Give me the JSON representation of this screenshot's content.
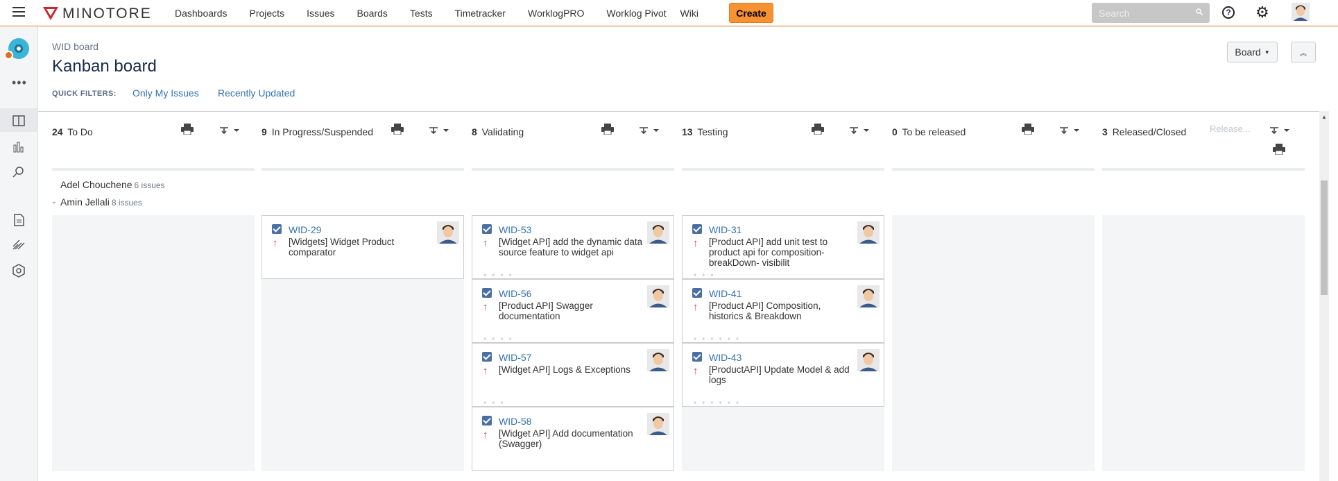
{
  "topbar": {
    "logo_text": "MINOTORE",
    "nav": [
      "Dashboards",
      "Projects",
      "Issues",
      "Boards",
      "Tests",
      "Timetracker",
      "WorklogPRO",
      "Worklog Pivot",
      "Wiki"
    ],
    "create_label": "Create",
    "search_placeholder": "Search",
    "help_glyph": "?",
    "accent": "#f79232"
  },
  "header": {
    "subtitle": "WID board",
    "title": "Kanban board",
    "board_button": "Board",
    "quick_filters_label": "QUICK FILTERS:",
    "quick_filters": [
      "Only My Issues",
      "Recently Updated"
    ]
  },
  "columns": [
    {
      "count": "24",
      "name": "To Do"
    },
    {
      "count": "9",
      "name": "In Progress/Suspended"
    },
    {
      "count": "8",
      "name": "Validating"
    },
    {
      "count": "13",
      "name": "Testing"
    },
    {
      "count": "0",
      "name": "To be released"
    },
    {
      "count": "3",
      "name": "Released/Closed",
      "release_text": "Release..."
    }
  ],
  "swimlanes": [
    {
      "name": "Adel Chouchene",
      "count": "6 issues"
    },
    {
      "name": "Amin Jellali",
      "count": "8 issues"
    }
  ],
  "cards": {
    "col1": [
      {
        "key": "WID-29",
        "summary": "[Widgets] Widget Product comparator"
      }
    ],
    "col2": [
      {
        "key": "WID-53",
        "summary": "[Widget API] add the dynamic data source feature to widget api"
      },
      {
        "key": "WID-56",
        "summary": "[Product API] Swagger documentation"
      },
      {
        "key": "WID-57",
        "summary": "[Widget API] Logs & Exceptions"
      },
      {
        "key": "WID-58",
        "summary": "[Widget API] Add documentation (Swagger)"
      }
    ],
    "col3": [
      {
        "key": "WID-31",
        "summary": "[Product API] add unit test to product api for composition- breakDown- visibilit"
      },
      {
        "key": "WID-41",
        "summary": "[Product API] Composition, historics & Breakdown"
      },
      {
        "key": "WID-43",
        "summary": "[ProductAPI] Update Model & add logs"
      }
    ]
  },
  "icons": {
    "priority": "priority-high-arrow-icon",
    "issue_type": "task-checkbox-icon"
  }
}
